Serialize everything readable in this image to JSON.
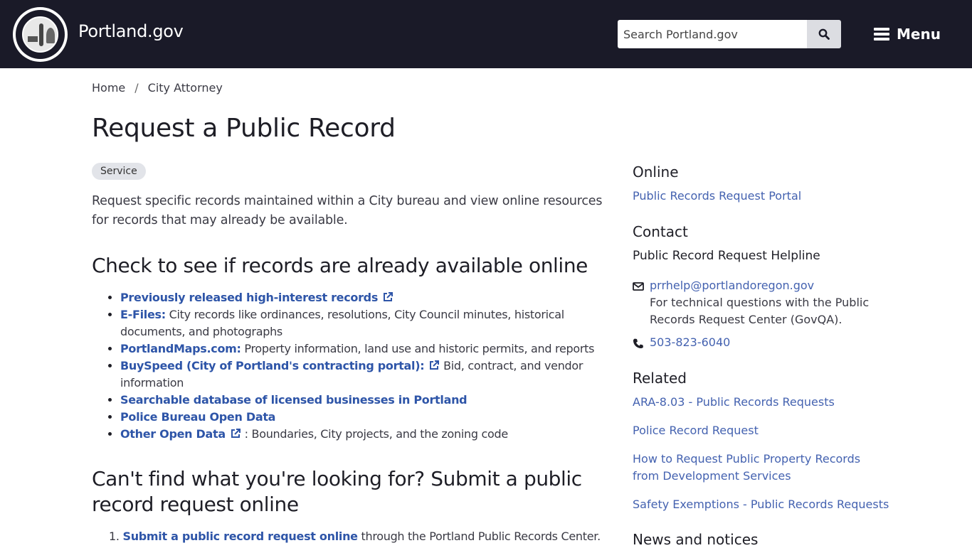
{
  "header": {
    "brand": "Portland.gov",
    "seal_alt": "City of Portland Oregon seal 1851",
    "search_placeholder": "Search Portland.gov",
    "search_icon": "search-icon",
    "menu_label": "Menu",
    "menu_icon": "hamburger-icon"
  },
  "breadcrumb": {
    "items": [
      "Home",
      "City Attorney"
    ],
    "separator": "/"
  },
  "page": {
    "title": "Request a Public Record",
    "badge": "Service",
    "intro": "Request specific records maintained within a City bureau and view online resources for records that may already be available."
  },
  "section_online": {
    "heading": "Check to see if records are already available online",
    "items": [
      {
        "link": "Previously released high-interest records",
        "external": true,
        "text": ""
      },
      {
        "link": "E-Files:",
        "external": false,
        "text": " City records like ordinances, resolutions, City Council minutes, historical documents, and photographs"
      },
      {
        "link": "PortlandMaps.com:",
        "external": false,
        "text": " Property information, land use and historic permits, and reports"
      },
      {
        "link": "BuySpeed (City of Portland's contracting portal):",
        "external": true,
        "text": " Bid, contract, and vendor information"
      },
      {
        "link": "Searchable database of licensed businesses in Portland",
        "external": false,
        "text": ""
      },
      {
        "link": "Police Bureau Open Data",
        "external": false,
        "text": ""
      },
      {
        "link": "Other Open Data",
        "external": true,
        "text": " : Boundaries, City projects, and the zoning code"
      }
    ]
  },
  "section_submit": {
    "heading": "Can't find what you're looking for? Submit a public record request online",
    "steps": [
      {
        "number": "1.",
        "link": "Submit a public record request online",
        "text": " through the Portland Public Records Center."
      }
    ]
  },
  "sidebar": {
    "online_heading": "Online",
    "online_link": "Public Records Request Portal",
    "contact_heading": "Contact",
    "contact_name": "Public Record Request Helpline",
    "email": "prrhelp@portlandoregon.gov",
    "email_note": "For technical questions with the Public Records Request Center (GovQA).",
    "phone": "503-823-6040",
    "related_heading": "Related",
    "related": [
      "ARA-8.03 - Public Records Requests",
      "Police Record Request",
      "How to Request Public Property Records from Development Services",
      "Safety Exemptions - Public Records Requests"
    ],
    "news_heading": "News and notices"
  },
  "colors": {
    "header_bg": "#1a1a28",
    "link": "#2e55a8",
    "sidebar_link": "#4462b0",
    "badge_bg": "#e2e4e9"
  }
}
